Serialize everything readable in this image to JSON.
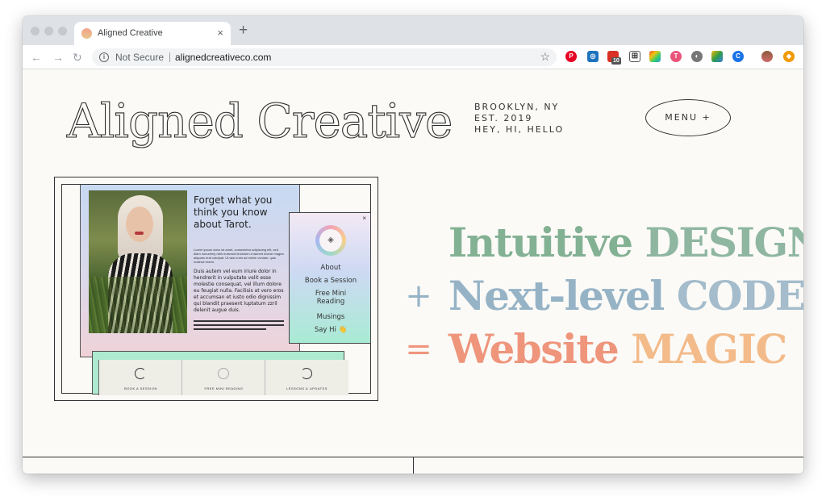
{
  "browser": {
    "tab_title": "Aligned Creative",
    "tab_close": "×",
    "new_tab": "+",
    "security_label": "Not Secure",
    "url": "alignedcreativeco.com",
    "extension_badge": "10"
  },
  "site": {
    "logo": "Aligned Creative",
    "info_lines": [
      "BROOKLYN, NY",
      "EST. 2019",
      "HEY, HI, HELLO"
    ],
    "menu_label": "MENU +",
    "tagline": {
      "line1": {
        "op": "",
        "word1": "Intuitive",
        "word2": "DESIGN"
      },
      "line2": {
        "op": "+",
        "word1": "Next-level",
        "word2": "CODE"
      },
      "line3": {
        "op": "=",
        "word1": "Website",
        "word2": "MAGIC"
      }
    },
    "colors": {
      "line1_a": "#83b193",
      "line1_b": "#8fb6a0",
      "line2_a": "#96b3c6",
      "line2_b": "#a4bccb",
      "line3_a": "#ee957c",
      "line3_b": "#f3bb8a"
    }
  },
  "mockup": {
    "heading": "Forget what you think you know about Tarot.",
    "lorem": "Lorem ipsum dolor sit amet, consectetur adipiscing elit, sed diam nonummy nibh euismod tincidunt ut laoreet dolore magna aliquam erat volutpat. Ut wisi enim ad minim veniam, quis nostrud exerci.",
    "bold_text": "Duis autem vel eum iriure dolor in hendrerit in vulputate velit esse molestie consequat, vel illum dolore eu feugiat nulla. Facilisis at vero eros et accumsan et iusto odio dignissim qui blandit praesent luptatum zzril delenit augue duis.",
    "menu_close": "×",
    "menu_items": [
      "About",
      "Book a Session",
      "Free Mini Reading",
      "Musings",
      "Say Hi 👋"
    ],
    "strip_labels": [
      "BOOK A SESSION",
      "FREE MINI READING",
      "LESSONS & UPDATES"
    ]
  }
}
